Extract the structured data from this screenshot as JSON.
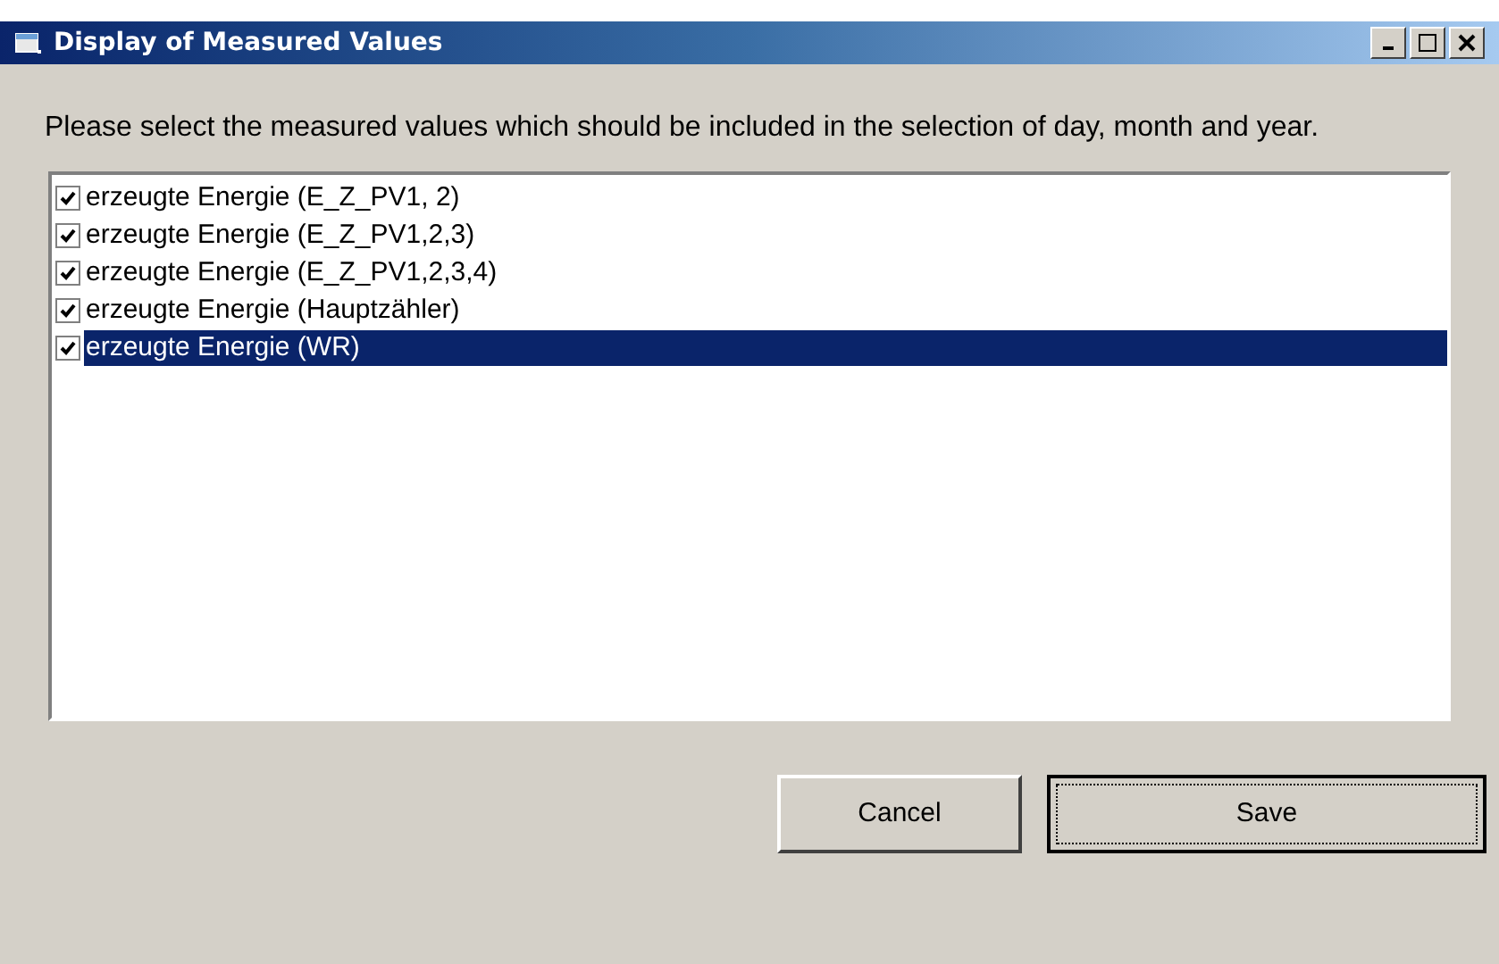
{
  "window": {
    "title": "Display of Measured Values"
  },
  "instruction": "Please select the measured values which should be included in the selection of day, month and year.",
  "items": [
    {
      "label": "erzeugte Energie (E_Z_PV1, 2)",
      "checked": true,
      "selected": false
    },
    {
      "label": "erzeugte Energie (E_Z_PV1,2,3)",
      "checked": true,
      "selected": false
    },
    {
      "label": "erzeugte Energie (E_Z_PV1,2,3,4)",
      "checked": true,
      "selected": false
    },
    {
      "label": "erzeugte Energie (Hauptzähler)",
      "checked": true,
      "selected": false
    },
    {
      "label": "erzeugte Energie (WR)",
      "checked": true,
      "selected": true
    }
  ],
  "buttons": [
    {
      "label": "Cancel",
      "default": false
    },
    {
      "label": "Save",
      "default": true
    }
  ]
}
